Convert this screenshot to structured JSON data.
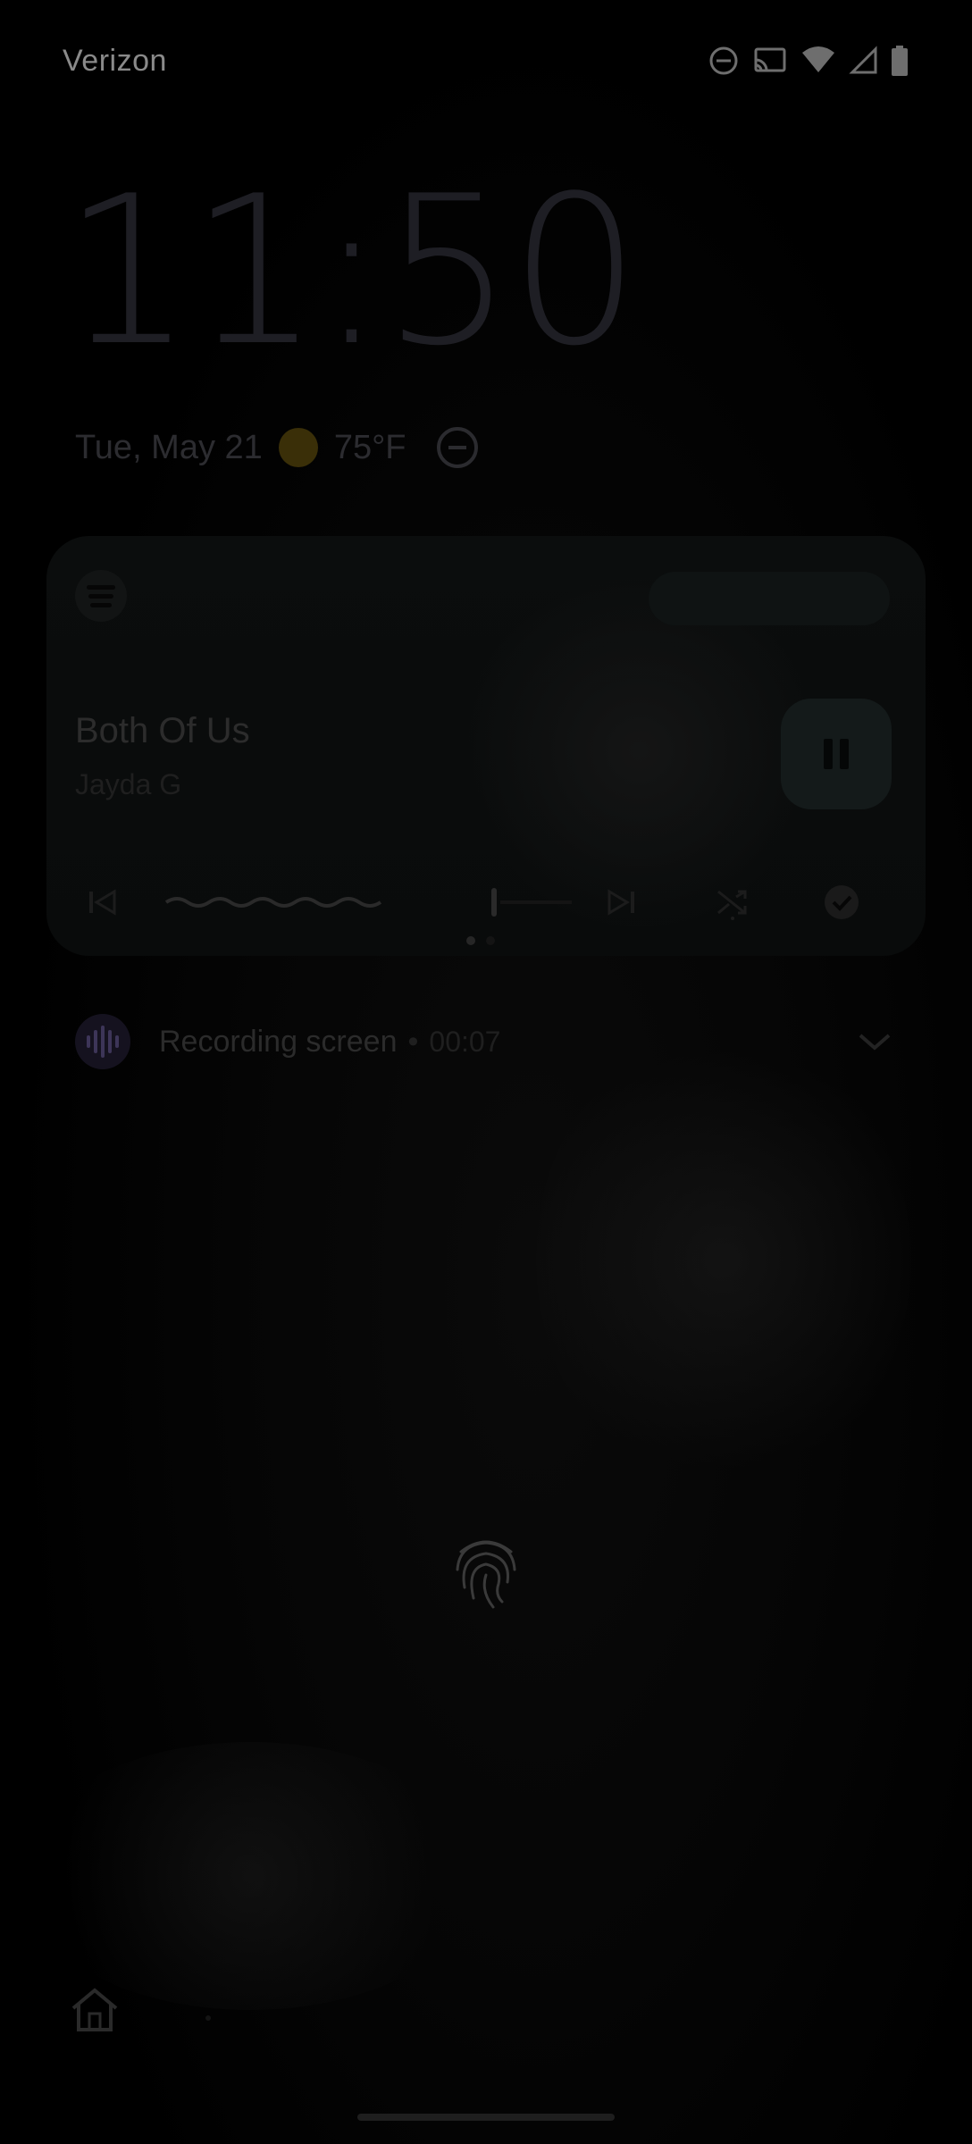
{
  "status_bar": {
    "carrier": "Verizon",
    "icons": [
      "do-not-disturb-icon",
      "cast-icon",
      "wifi-icon",
      "cell-signal-icon",
      "battery-icon"
    ]
  },
  "lock_screen": {
    "clock": "11:50",
    "date": "Tue, May 21",
    "weather_icon": "sun-icon",
    "temperature": "75°F",
    "dnd_icon": "do-not-disturb-icon"
  },
  "media_player": {
    "app_icon": "spotify-icon",
    "song_title": "Both Of Us",
    "artist": "Jayda G",
    "play_state": "playing",
    "controls": [
      "previous-icon",
      "next-icon",
      "shuffle-icon",
      "check-icon"
    ],
    "page_indicator": {
      "count": 2,
      "active": 0
    }
  },
  "notification": {
    "icon": "screen-record-icon",
    "label": "Recording screen",
    "separator": "•",
    "elapsed": "00:07",
    "expand_icon": "chevron-down-icon"
  },
  "unlock": {
    "icon": "fingerprint-icon"
  },
  "shortcuts": {
    "left_icon": "home-icon"
  },
  "colors": {
    "background": "#000000",
    "card": "#0b0d0d",
    "accent_dim": "#3a2f08"
  }
}
